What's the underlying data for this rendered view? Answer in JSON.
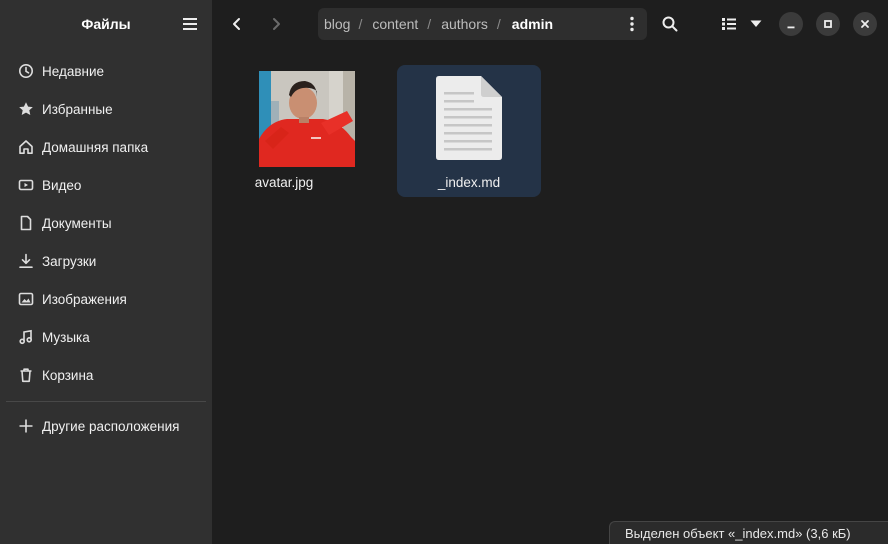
{
  "sidebar": {
    "title": "Файлы",
    "places": [
      {
        "label": "Недавние",
        "icon": "clock-icon"
      },
      {
        "label": "Избранные",
        "icon": "star-icon"
      },
      {
        "label": "Домашняя папка",
        "icon": "home-icon"
      },
      {
        "label": "Видео",
        "icon": "video-icon"
      },
      {
        "label": "Документы",
        "icon": "document-icon"
      },
      {
        "label": "Загрузки",
        "icon": "download-icon"
      },
      {
        "label": "Изображения",
        "icon": "image-icon"
      },
      {
        "label": "Музыка",
        "icon": "music-icon"
      },
      {
        "label": "Корзина",
        "icon": "trash-icon"
      }
    ],
    "other_locations": {
      "label": "Другие расположения",
      "icon": "plus-icon"
    }
  },
  "path": {
    "crumbs": [
      "blog",
      "content",
      "authors",
      "admin"
    ],
    "current": "admin"
  },
  "files": [
    {
      "name": "avatar.jpg",
      "type": "image",
      "selected": false
    },
    {
      "name": "_index.md",
      "type": "text",
      "selected": true
    }
  ],
  "status": "Выделен объект «_index.md» (3,6 кБ)",
  "colors": {
    "selection": "#243347",
    "sidebar": "#303030",
    "background": "#1e1e1e"
  }
}
